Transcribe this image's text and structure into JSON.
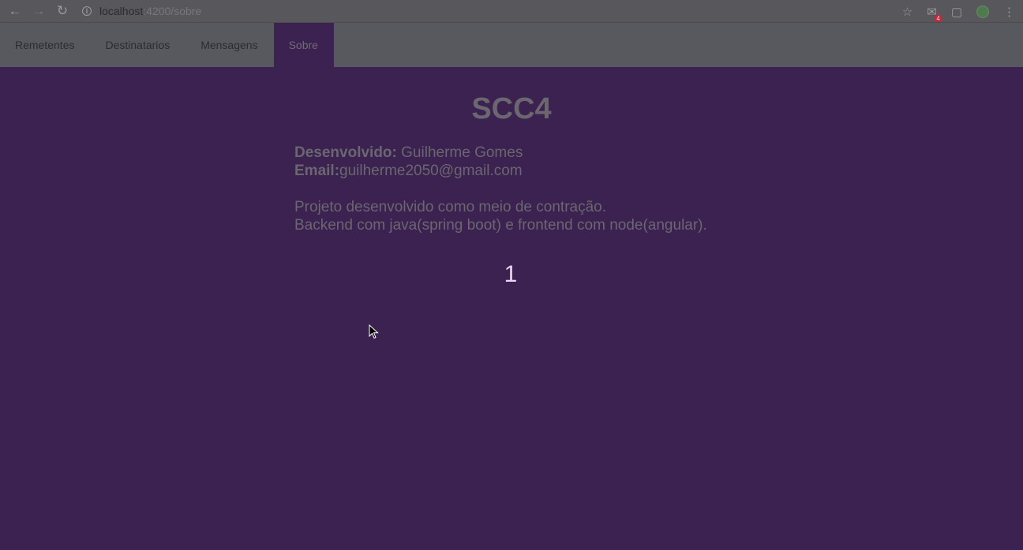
{
  "browser": {
    "url_host": "localhost",
    "url_path": ":4200/sobre",
    "mail_badge": "4"
  },
  "nav": {
    "tabs": [
      {
        "label": "Remetentes"
      },
      {
        "label": "Destinatarios"
      },
      {
        "label": "Mensagens"
      },
      {
        "label": "Sobre",
        "active": true
      }
    ]
  },
  "content": {
    "title": "SCC4",
    "developer_label": "Desenvolvido:",
    "developer_value": " Guilherme Gomes",
    "email_label": "Email:",
    "email_value": "guilherme2050@gmail.com",
    "description_line1": "Projeto desenvolvido como meio de contração.",
    "description_line2": "Backend com java(spring boot) e frontend com node(angular).",
    "counter": "1"
  }
}
